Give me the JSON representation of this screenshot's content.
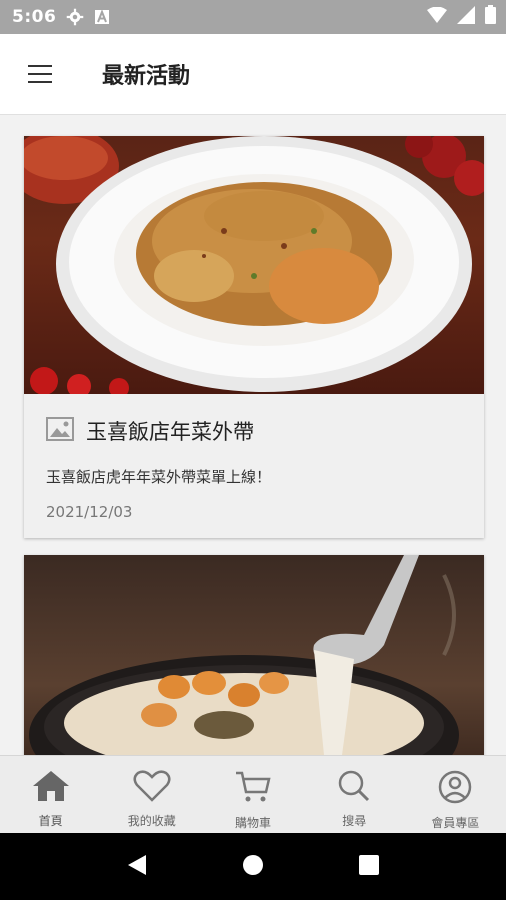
{
  "status_bar": {
    "time": "5:06",
    "icons": [
      "gear-icon",
      "font-icon",
      "wifi-icon",
      "signal-icon",
      "battery-icon"
    ]
  },
  "app_bar": {
    "title": "最新活動",
    "menu_icon": "hamburger-icon"
  },
  "cards": [
    {
      "image": "plate-dish-photo",
      "title_icon": "image-icon",
      "title": "玉喜飯店年菜外帶",
      "description": "玉喜飯店虎年年菜外帶菜單上線！",
      "date": "2021/12/03"
    },
    {
      "image": "soup-pot-photo"
    }
  ],
  "bottom_nav": [
    {
      "icon": "home-icon",
      "label": "首頁",
      "active": true
    },
    {
      "icon": "heart-icon",
      "label": "我的收藏"
    },
    {
      "icon": "cart-icon",
      "label": "購物車"
    },
    {
      "icon": "search-icon",
      "label": "搜尋"
    },
    {
      "icon": "user-icon",
      "label": "會員專區"
    }
  ],
  "colors": {
    "status_bar": "#a5a5a5",
    "nav_icon": "#777777",
    "nav_active_icon": "#666666",
    "system_nav": "#000000"
  }
}
